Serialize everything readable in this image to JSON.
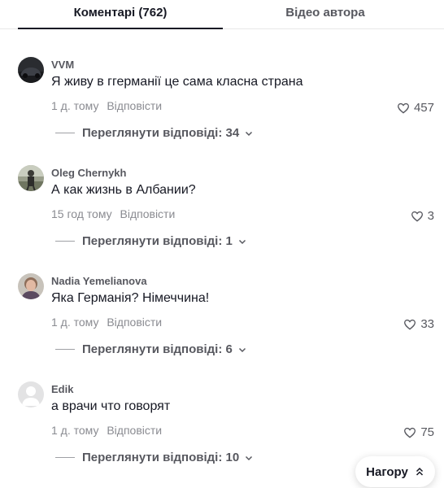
{
  "tabs": {
    "comments": "Коментарі (762)",
    "creator_videos": "Відео автора"
  },
  "comments": [
    {
      "username": "VVM",
      "text": "Я живу в ггерманії це сама класна страна",
      "time": "1 д. тому",
      "reply": "Відповісти",
      "likes": "457",
      "view_replies": "Переглянути відповіді: 34"
    },
    {
      "username": "Oleg Chernykh",
      "text": "А как жизнь в Албании?",
      "time": "15 год тому",
      "reply": "Відповісти",
      "likes": "3",
      "view_replies": "Переглянути відповіді: 1"
    },
    {
      "username": "Nadia Yemelianova",
      "text": "Яка Германія? Німеччина!",
      "time": "1 д. тому",
      "reply": "Відповісти",
      "likes": "33",
      "view_replies": "Переглянути відповіді: 6"
    },
    {
      "username": "Edik",
      "text": "а врачи что говорят",
      "time": "1 д. тому",
      "reply": "Відповісти",
      "likes": "75",
      "view_replies": "Переглянути відповіді: 10"
    }
  ],
  "back_to_top": "Нагору",
  "icons": {
    "like": "heart-outline-icon",
    "expand": "chevron-down-icon",
    "top": "double-chevron-up-icon"
  },
  "colors": {
    "primary_text": "#161823",
    "secondary_text": "#8a8b91",
    "username": "#57585f"
  }
}
